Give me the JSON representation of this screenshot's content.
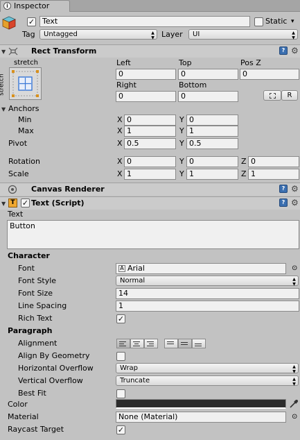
{
  "tab": {
    "label": "Inspector",
    "icon": "info-icon"
  },
  "object": {
    "name": "Text",
    "active": true,
    "static_label": "Static",
    "static": false,
    "static_arrow": "▾",
    "tag_label": "Tag",
    "tag_value": "Untagged",
    "layer_label": "Layer",
    "layer_value": "UI"
  },
  "rect_transform": {
    "title": "Rect Transform",
    "preset_label": "stretch",
    "preset_side": "stretch",
    "left_label": "Left",
    "left": "0",
    "top_label": "Top",
    "top": "0",
    "posz_label": "Pos Z",
    "posz": "0",
    "right_label": "Right",
    "right": "0",
    "bottom_label": "Bottom",
    "bottom": "0",
    "r_button": "R",
    "anchors_label": "Anchors",
    "min_label": "Min",
    "min_x": "0",
    "min_y": "0",
    "max_label": "Max",
    "max_x": "1",
    "max_y": "1",
    "pivot_label": "Pivot",
    "pivot_x": "0.5",
    "pivot_y": "0.5",
    "rotation_label": "Rotation",
    "rot_x": "0",
    "rot_y": "0",
    "rot_z": "0",
    "scale_label": "Scale",
    "scale_x": "1",
    "scale_y": "1",
    "scale_z": "1",
    "x": "X",
    "y": "Y",
    "z": "Z"
  },
  "canvas_renderer": {
    "title": "Canvas Renderer"
  },
  "text_script": {
    "title": "Text (Script)",
    "enabled": true,
    "text_label": "Text",
    "text_value": "Button",
    "character_label": "Character",
    "font_label": "Font",
    "font_value": "Arial",
    "font_style_label": "Font Style",
    "font_style_value": "Normal",
    "font_size_label": "Font Size",
    "font_size_value": "14",
    "line_spacing_label": "Line Spacing",
    "line_spacing_value": "1",
    "rich_text_label": "Rich Text",
    "rich_text": true,
    "paragraph_label": "Paragraph",
    "alignment_label": "Alignment",
    "align_by_geometry_label": "Align By Geometry",
    "align_by_geometry": false,
    "h_overflow_label": "Horizontal Overflow",
    "h_overflow_value": "Wrap",
    "v_overflow_label": "Vertical Overflow",
    "v_overflow_value": "Truncate",
    "best_fit_label": "Best Fit",
    "best_fit": false,
    "color_label": "Color",
    "color_value": "#2b2b2b",
    "material_label": "Material",
    "material_value": "None (Material)",
    "raycast_label": "Raycast Target",
    "raycast": true
  },
  "glyphs": {
    "check": "✓",
    "arrow": "▲▼",
    "foldout_open": "▼",
    "help": "?",
    "gear": "⚙",
    "circle": "⊙"
  }
}
